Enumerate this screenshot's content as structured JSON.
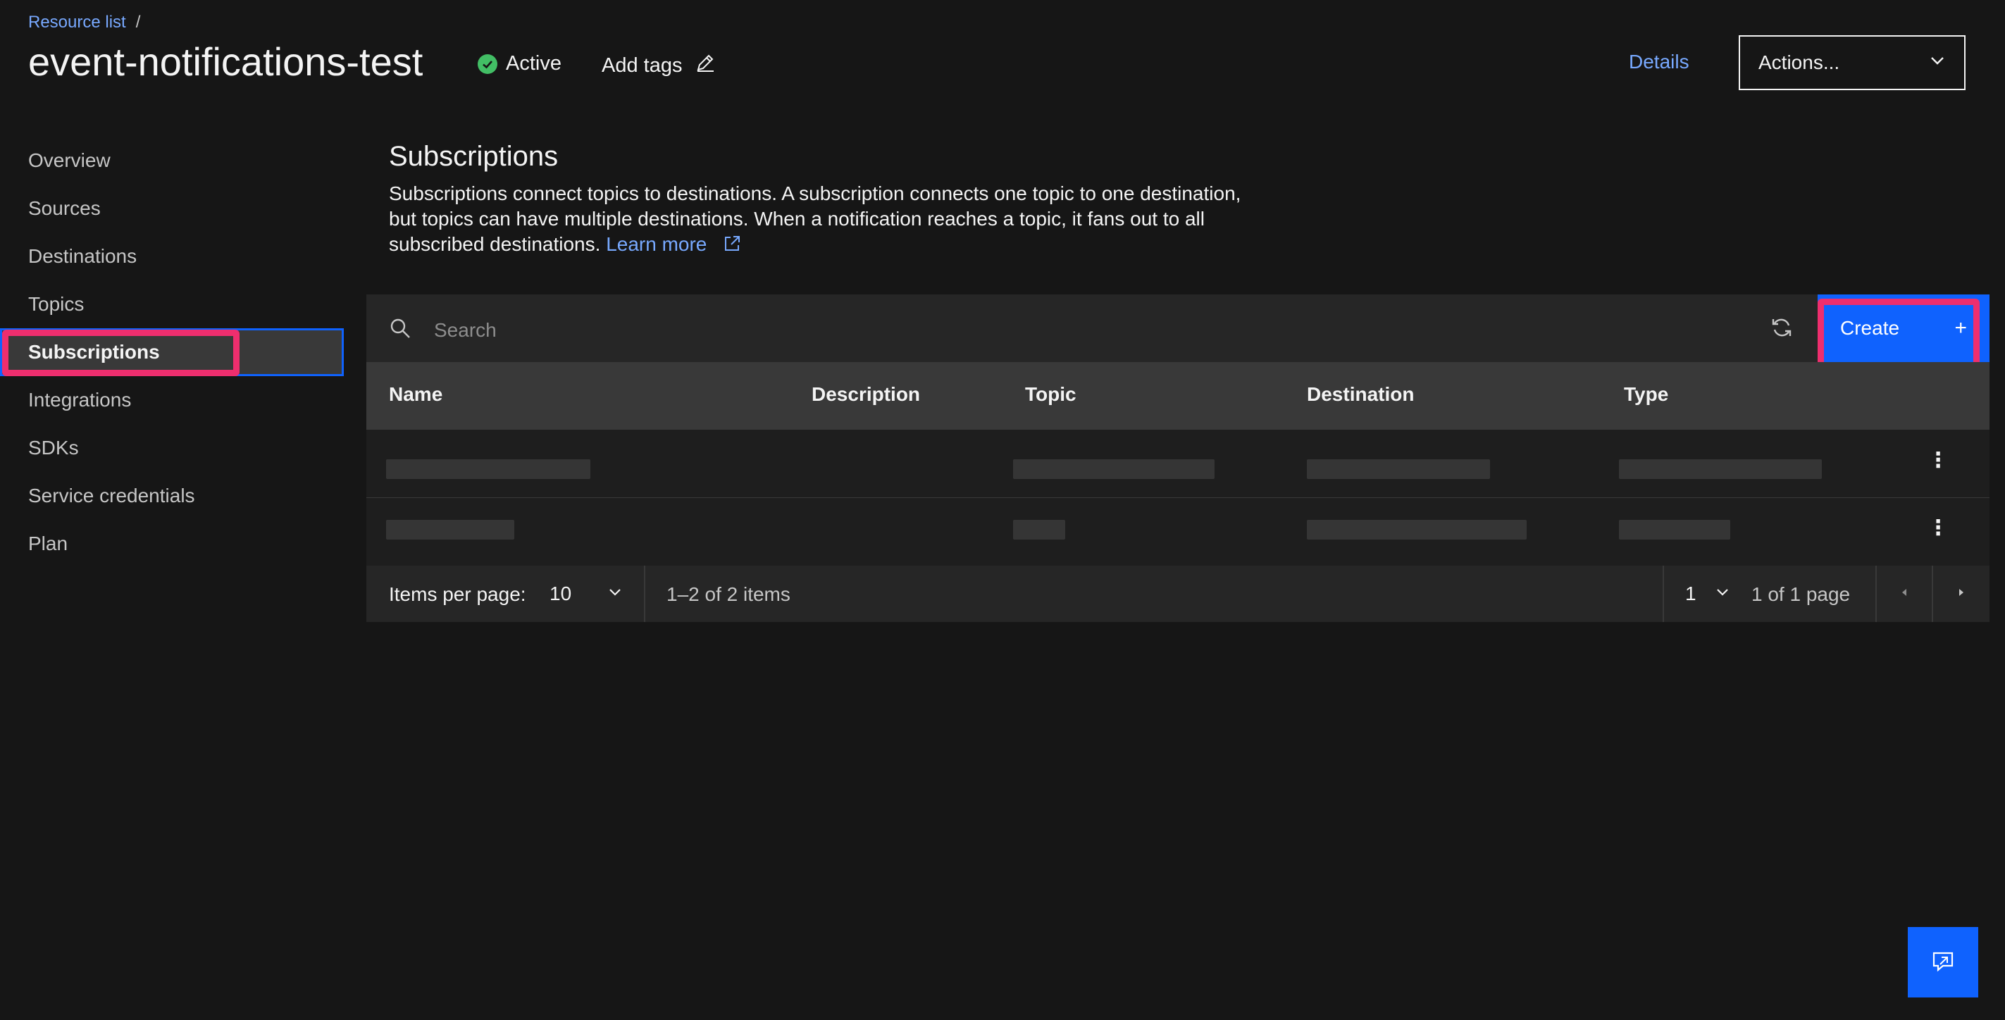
{
  "breadcrumb": {
    "link": "Resource list",
    "separator": "/"
  },
  "header": {
    "title": "event-notifications-test",
    "status": "Active",
    "add_tags": "Add tags",
    "details": "Details",
    "actions": "Actions..."
  },
  "sidebar": {
    "items": [
      {
        "label": "Overview"
      },
      {
        "label": "Sources"
      },
      {
        "label": "Destinations"
      },
      {
        "label": "Topics"
      },
      {
        "label": "Subscriptions",
        "selected": true
      },
      {
        "label": "Integrations"
      },
      {
        "label": "SDKs"
      },
      {
        "label": "Service credentials"
      },
      {
        "label": "Plan"
      }
    ]
  },
  "section": {
    "title": "Subscriptions",
    "desc_line1": "Subscriptions connect topics to destinations. A subscription connects one topic to one destination,",
    "desc_line2": "but topics can have multiple destinations. When a notification reaches a topic, it fans out to all",
    "desc_line3": "subscribed destinations.",
    "learn_more": "Learn more"
  },
  "toolbar": {
    "search_placeholder": "Search",
    "create": "Create",
    "create_icon": "+"
  },
  "table": {
    "columns": [
      "Name",
      "Description",
      "Topic",
      "Destination",
      "Type"
    ],
    "rows_note": "2 rows, cell contents pixelated/obscured"
  },
  "pagination": {
    "items_per_page_label": "Items per page:",
    "items_per_page_value": "10",
    "range": "1–2 of 2 items",
    "page_value": "1",
    "page_total": "1 of 1 page"
  },
  "colors": {
    "background": "#161616",
    "accent": "#0f62fe",
    "link": "#78a9ff",
    "success": "#42be65",
    "highlight": "#ee2e6e"
  },
  "icons": [
    "check-circle-icon",
    "edit-icon",
    "chevron-down-icon",
    "external-link-icon",
    "search-icon",
    "refresh-icon",
    "add-icon",
    "overflow-menu-icon",
    "caret-left-icon",
    "caret-right-icon",
    "feedback-icon"
  ]
}
